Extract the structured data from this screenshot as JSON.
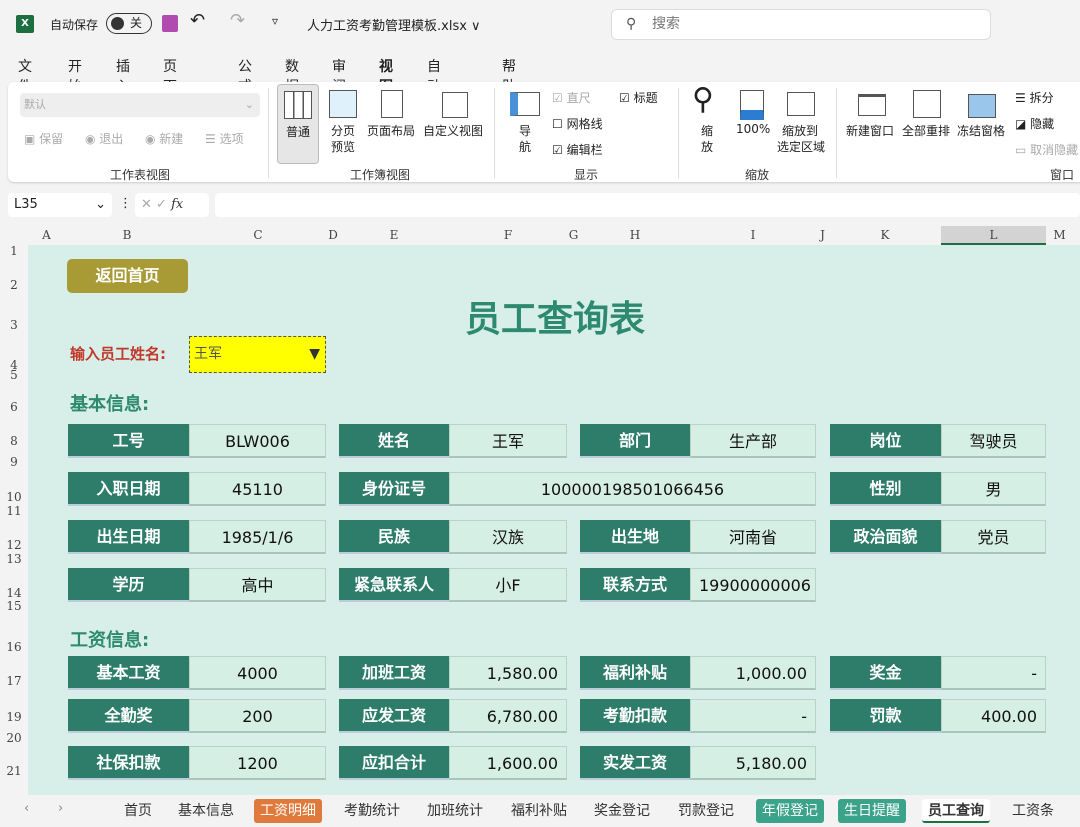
{
  "titlebar": {
    "autosave_label": "自动保存",
    "autosave_state": "关",
    "filename": "人力工资考勤管理模板.xlsx ∨",
    "search_placeholder": "搜索"
  },
  "menu": [
    {
      "label": "文件"
    },
    {
      "label": "开始"
    },
    {
      "label": "插入"
    },
    {
      "label": "页面布局"
    },
    {
      "label": "公式"
    },
    {
      "label": "数据"
    },
    {
      "label": "审阅"
    },
    {
      "label": "视图",
      "active": true
    },
    {
      "label": "自动执行"
    },
    {
      "label": "帮助"
    }
  ],
  "ribbon": {
    "sheet_view": {
      "select": "默认",
      "keep": "保留",
      "exit": "退出",
      "new": "新建",
      "options": "选项",
      "group": "工作表视图"
    },
    "workbook_view": {
      "normal": "普通",
      "page_break_1": "分页",
      "page_break_2": "预览",
      "page_layout": "页面布局",
      "custom": "自定义视图",
      "group": "工作簿视图"
    },
    "show": {
      "nav_1": "导",
      "nav_2": "航",
      "ruler": "直尺",
      "gridlines": "网格线",
      "formula_bar": "编辑栏",
      "headings": "标题",
      "group": "显示"
    },
    "zoom": {
      "zoom_1": "缩",
      "zoom_2": "放",
      "hundred": "100%",
      "to_sel_1": "缩放到",
      "to_sel_2": "选定区域",
      "group": "缩放"
    },
    "window": {
      "new": "新建窗口",
      "arrange": "全部重排",
      "freeze": "冻结窗格",
      "split": "拆分",
      "hide": "隐藏",
      "unhide": "取消隐藏",
      "group": "窗口"
    }
  },
  "formula_bar": {
    "name_box": "L35",
    "fx": "fx",
    "value": ""
  },
  "columns": [
    "A",
    "B",
    "C",
    "D",
    "E",
    "F",
    "G",
    "H",
    "I",
    "J",
    "K",
    "L",
    "M"
  ],
  "rows": [
    "1",
    "2",
    "3",
    "4",
    "5",
    "6",
    "8",
    "9",
    "10",
    "11",
    "12",
    "13",
    "14",
    "15",
    "16",
    "17",
    "19",
    "20",
    "21"
  ],
  "sheet": {
    "home_button": "返回首页",
    "title": "员工查询表",
    "prompt": "输入员工姓名:",
    "selected_name": "王军",
    "basic_section": "基本信息:",
    "salary_section": "工资信息:",
    "basic": [
      [
        {
          "label": "工号",
          "value": "BLW006"
        },
        {
          "label": "姓名",
          "value": "王军"
        },
        {
          "label": "部门",
          "value": "生产部"
        },
        {
          "label": "岗位",
          "value": "驾驶员"
        }
      ],
      [
        {
          "label": "入职日期",
          "value": "45110"
        },
        {
          "label": "身份证号",
          "value": "100000198501066456"
        },
        null,
        {
          "label": "性别",
          "value": "男"
        }
      ],
      [
        {
          "label": "出生日期",
          "value": "1985/1/6"
        },
        {
          "label": "民族",
          "value": "汉族"
        },
        {
          "label": "出生地",
          "value": "河南省"
        },
        {
          "label": "政治面貌",
          "value": "党员"
        }
      ],
      [
        {
          "label": "学历",
          "value": "高中"
        },
        {
          "label": "紧急联系人",
          "value": "小F"
        },
        {
          "label": "联系方式",
          "value": "19900000006"
        },
        null
      ]
    ],
    "salary": [
      [
        {
          "label": "基本工资",
          "value": "4000"
        },
        {
          "label": "加班工资",
          "value": "1,580.00"
        },
        {
          "label": "福利补贴",
          "value": "1,000.00"
        },
        {
          "label": "奖金",
          "value": "-"
        }
      ],
      [
        {
          "label": "全勤奖",
          "value": "200"
        },
        {
          "label": "应发工资",
          "value": "6,780.00"
        },
        {
          "label": "考勤扣款",
          "value": "-"
        },
        {
          "label": "罚款",
          "value": "400.00"
        }
      ],
      [
        {
          "label": "社保扣款",
          "value": "1200"
        },
        {
          "label": "应扣合计",
          "value": "1,600.00"
        },
        {
          "label": "实发工资",
          "value": "5,180.00"
        },
        null
      ]
    ]
  },
  "sheet_tabs": [
    {
      "label": "首页"
    },
    {
      "label": "基本信息"
    },
    {
      "label": "工资明细",
      "color": "#e07a3c"
    },
    {
      "label": "考勤统计"
    },
    {
      "label": "加班统计"
    },
    {
      "label": "福利补贴"
    },
    {
      "label": "奖金登记"
    },
    {
      "label": "罚款登记"
    },
    {
      "label": "年假登记",
      "color": "#3aa38a"
    },
    {
      "label": "生日提醒",
      "color": "#3aa38a"
    },
    {
      "label": "员工查询",
      "active": true
    },
    {
      "label": "工资条"
    }
  ],
  "colors": {
    "label_bg": "#2e7d6a",
    "value_bg": "#d6efe4",
    "sheet_bg": "#d8efe9",
    "accent": "#1d6f42"
  }
}
